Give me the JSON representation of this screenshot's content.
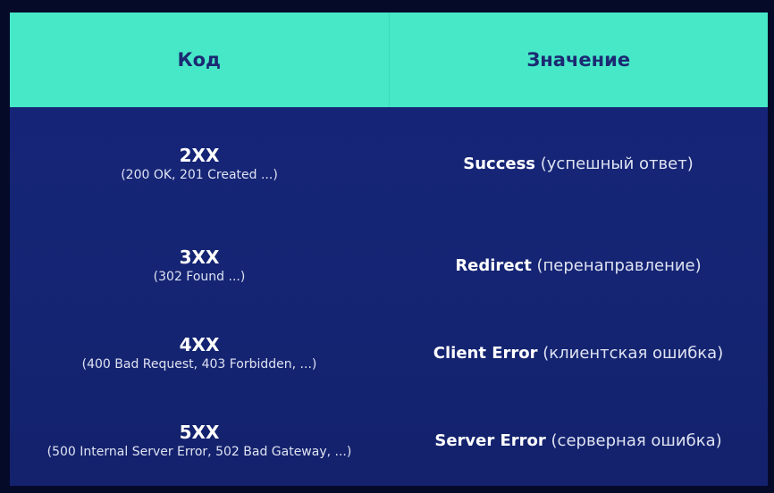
{
  "header": {
    "code_label": "Код",
    "meaning_label": "Значение"
  },
  "rows": [
    {
      "code": "2XX",
      "examples": "(200 OK, 201 Created ...)",
      "meaning_bold": "Success",
      "meaning_rest": " (успешный ответ)"
    },
    {
      "code": "3XX",
      "examples": "(302 Found ...)",
      "meaning_bold": "Redirect",
      "meaning_rest": " (перенаправление)"
    },
    {
      "code": "4XX",
      "examples": "(400 Bad Request, 403 Forbidden, ...)",
      "meaning_bold": "Client Error",
      "meaning_rest": " (клиентская ошибка)"
    },
    {
      "code": "5XX",
      "examples": "(500 Internal Server Error, 502 Bad Gateway, ...)",
      "meaning_bold": "Server Error",
      "meaning_rest": " (серверная ошибка)"
    }
  ],
  "colors": {
    "header_bg": "#46e8c7",
    "header_text": "#1b2a72",
    "body_bg": "#17247a",
    "outer_bg": "#050a29"
  }
}
